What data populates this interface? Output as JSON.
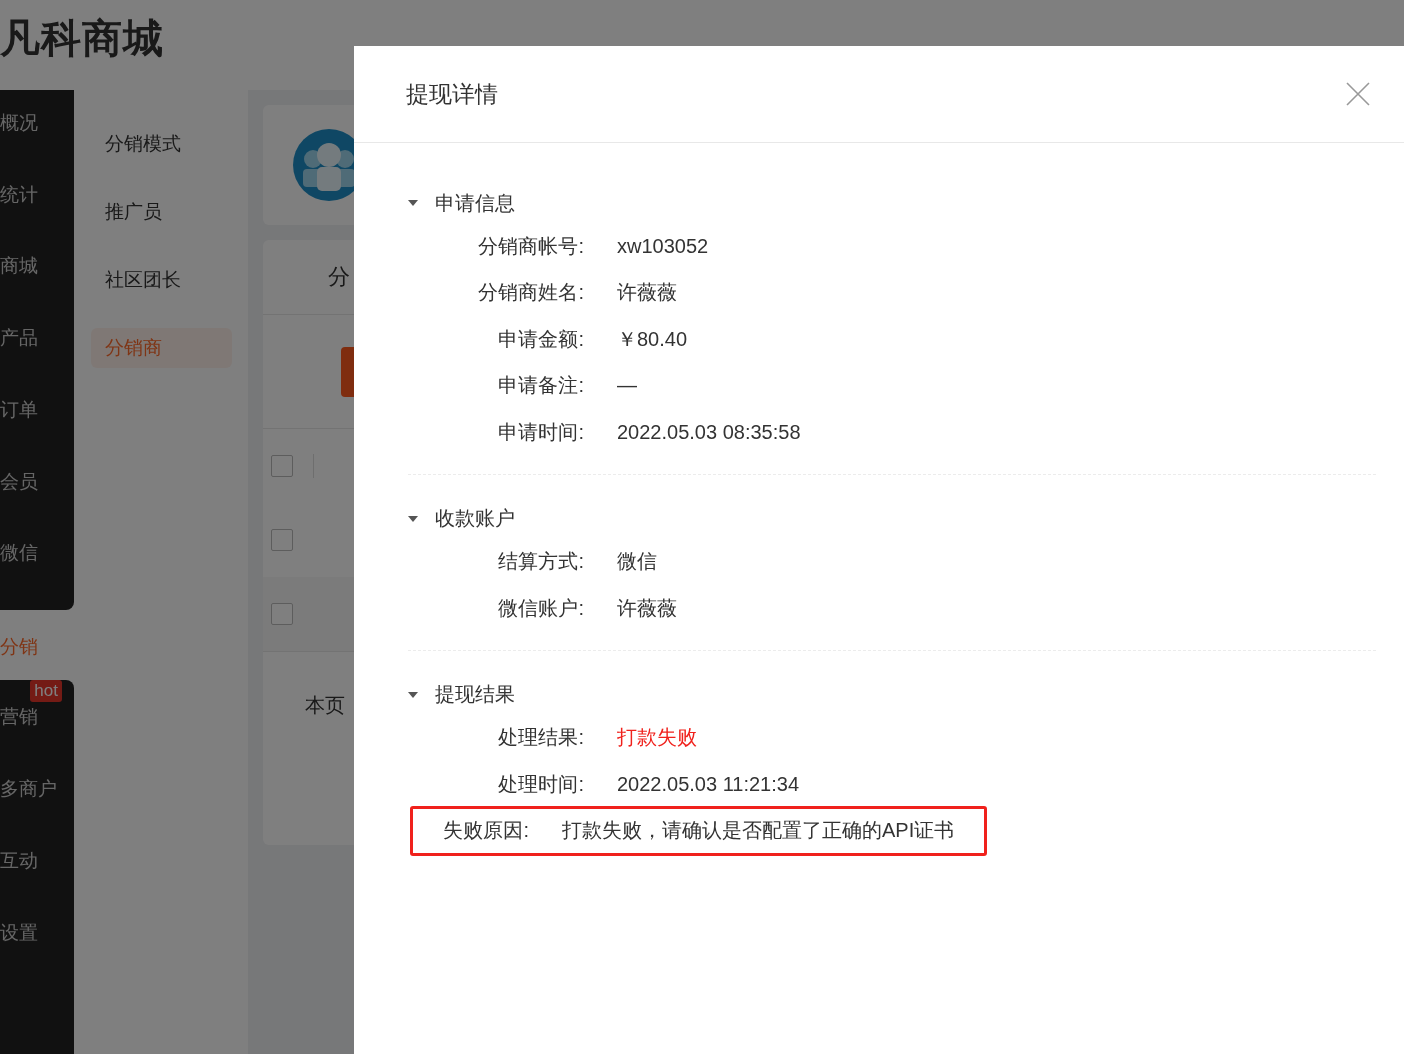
{
  "logo": "凡科商城",
  "main_nav": [
    {
      "kind": "block",
      "items": [
        {
          "label": "概况",
          "selected": false
        },
        {
          "label": "统计",
          "selected": false
        },
        {
          "label": "商城",
          "selected": false
        },
        {
          "label": "产品",
          "selected": false
        },
        {
          "label": "订单",
          "selected": false
        },
        {
          "label": "会员",
          "selected": false
        },
        {
          "label": "微信",
          "selected": false
        }
      ]
    },
    {
      "kind": "link",
      "label": "分销",
      "selected": true
    },
    {
      "kind": "block",
      "badge": "hot",
      "items": [
        {
          "label": "营销",
          "selected": false
        },
        {
          "label": "多商户",
          "selected": false
        },
        {
          "label": "互动",
          "selected": false
        },
        {
          "label": "设置",
          "selected": false
        }
      ]
    }
  ],
  "sub_nav": [
    {
      "label": "分销模式",
      "selected": false
    },
    {
      "label": "推广员",
      "selected": false
    },
    {
      "label": "社区团长",
      "selected": false
    },
    {
      "label": "分销商",
      "selected": true
    }
  ],
  "content": {
    "tab": "分",
    "table_rows": [
      {
        "checked": false
      },
      {
        "checked": false
      },
      {
        "checked": false
      }
    ],
    "footer": "本页"
  },
  "dialog": {
    "title": "提现详情",
    "sections": [
      {
        "title": "申请信息",
        "expanded": true,
        "fields": [
          {
            "label": "分销商帐号:",
            "value": "xw103052"
          },
          {
            "label": "分销商姓名:",
            "value": "许薇薇"
          },
          {
            "label": "申请金额:",
            "value": "￥80.40"
          },
          {
            "label": "申请备注:",
            "value": "—"
          },
          {
            "label": "申请时间:",
            "value": "2022.05.03 08:35:58"
          }
        ]
      },
      {
        "title": "收款账户",
        "expanded": true,
        "fields": [
          {
            "label": "结算方式:",
            "value": "微信"
          },
          {
            "label": "微信账户:",
            "value": "许薇薇"
          }
        ]
      },
      {
        "title": "提现结果",
        "expanded": true,
        "fields": [
          {
            "label": "处理结果:",
            "value": "打款失败",
            "kind": "error"
          },
          {
            "label": "处理时间:",
            "value": "2022.05.03 11:21:34"
          },
          {
            "label": "失败原因:",
            "value": "打款失败，请确认是否配置了正确的API证书",
            "highlighted": true
          }
        ]
      }
    ]
  }
}
